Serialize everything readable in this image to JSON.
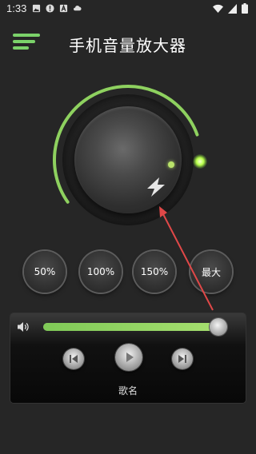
{
  "status_bar": {
    "time": "1:33",
    "left_icons": [
      "image-icon",
      "alert-icon",
      "text-a-icon",
      "cloud-icon"
    ],
    "right_icons": [
      "wifi-icon",
      "signal-icon",
      "battery-icon"
    ]
  },
  "header": {
    "title": "手机音量放大器",
    "menu_icon": "menu-icon"
  },
  "knob": {
    "center_icon": "lightning-icon",
    "level_fraction": 0.78,
    "accent_color": "#8ed15f"
  },
  "presets": [
    {
      "label": "50%"
    },
    {
      "label": "100%"
    },
    {
      "label": "150%"
    },
    {
      "label": "最大"
    }
  ],
  "player": {
    "volume_icon": "speaker-icon",
    "volume_fraction": 0.96,
    "controls": [
      "prev-icon",
      "play-icon",
      "next-icon"
    ],
    "song_name": "歌名"
  },
  "colors": {
    "background": "#262626",
    "accent": "#8ed15f",
    "annotation_arrow": "#e04848"
  }
}
